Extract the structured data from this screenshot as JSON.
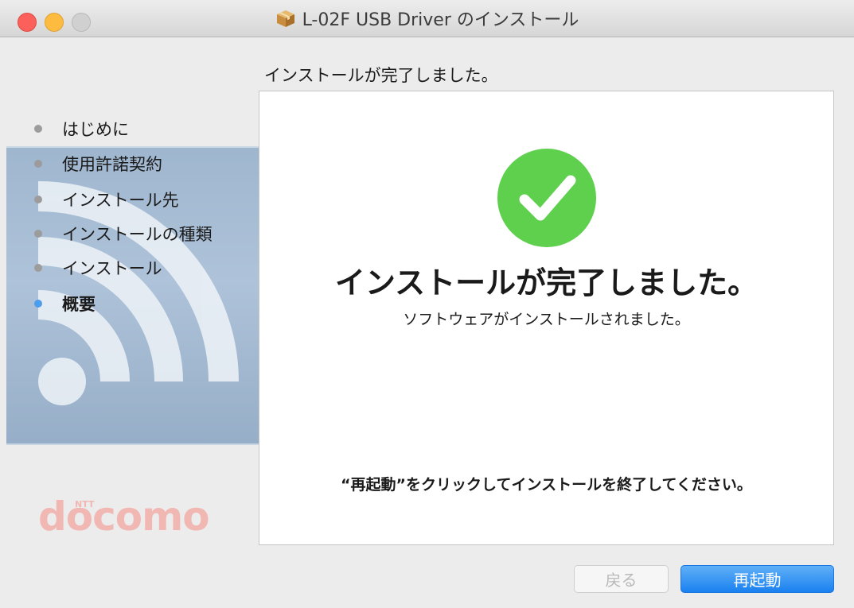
{
  "window": {
    "title": "L-02F USB Driver のインストール",
    "title_icon": "package-icon",
    "controls": [
      "close",
      "minimize",
      "zoom"
    ]
  },
  "sidebar": {
    "steps": [
      {
        "label": "はじめに",
        "active": false
      },
      {
        "label": "使用許諾契約",
        "active": false
      },
      {
        "label": "インストール先",
        "active": false
      },
      {
        "label": "インストールの種類",
        "active": false
      },
      {
        "label": "インストール",
        "active": false
      },
      {
        "label": "概要",
        "active": true
      }
    ],
    "logo": {
      "brand": "docomo",
      "sub": "NTT"
    }
  },
  "main": {
    "heading": "インストールが完了しました。",
    "status_icon": "checkmark-icon",
    "title": "インストールが完了しました。",
    "subtitle": "ソフトウェアがインストールされました。",
    "note": "“再起動”をクリックしてインストールを終了してください。"
  },
  "buttons": {
    "back_label": "戻る",
    "back_enabled": false,
    "restart_label": "再起動"
  },
  "colors": {
    "accent": "#1b81f0",
    "success": "#5fd04e",
    "active_step": "#4d9ded",
    "brand_logo": "#f0b7b3"
  }
}
